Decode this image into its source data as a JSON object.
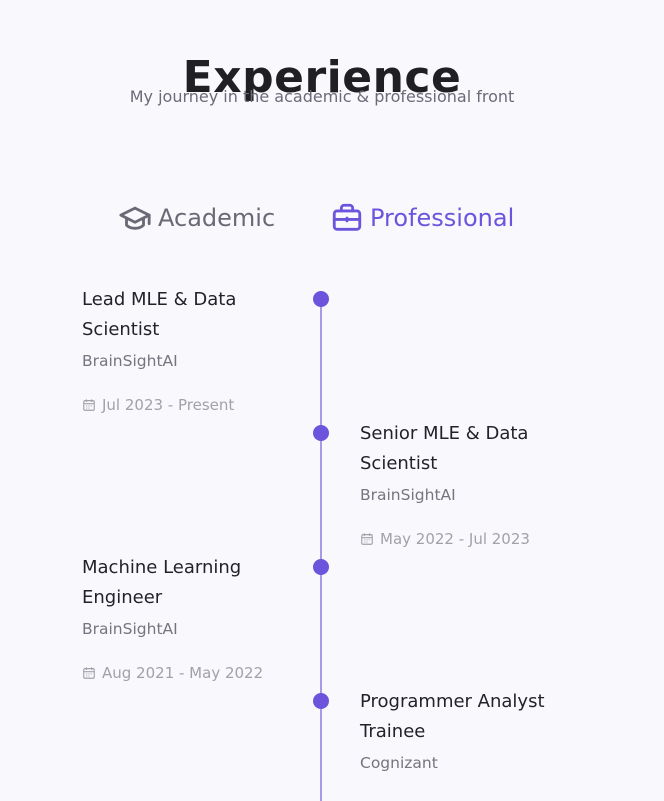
{
  "header": {
    "title": "Experience",
    "subtitle": "My journey in the academic & professional front"
  },
  "tabs": [
    {
      "label": "Academic",
      "icon": "graduation-cap-icon",
      "active": false
    },
    {
      "label": "Professional",
      "icon": "briefcase-icon",
      "active": true
    }
  ],
  "timeline": [
    {
      "role": "Lead MLE & Data Scientist",
      "org": "BrainSightAI",
      "dates": "Jul 2023 - Present",
      "side": "left"
    },
    {
      "role": "Senior MLE & Data Scientist",
      "org": "BrainSightAI",
      "dates": "May 2022 - Jul 2023",
      "side": "right"
    },
    {
      "role": "Machine Learning Engineer",
      "org": "BrainSightAI",
      "dates": "Aug 2021 - May 2022",
      "side": "left"
    },
    {
      "role": "Programmer Analyst Trainee",
      "org": "Cognizant",
      "dates": "",
      "side": "right"
    }
  ],
  "colors": {
    "accent": "#6d54dc",
    "line": "#a89be5",
    "background": "#f9f8fc",
    "inactive_tab": "#6a6975"
  }
}
